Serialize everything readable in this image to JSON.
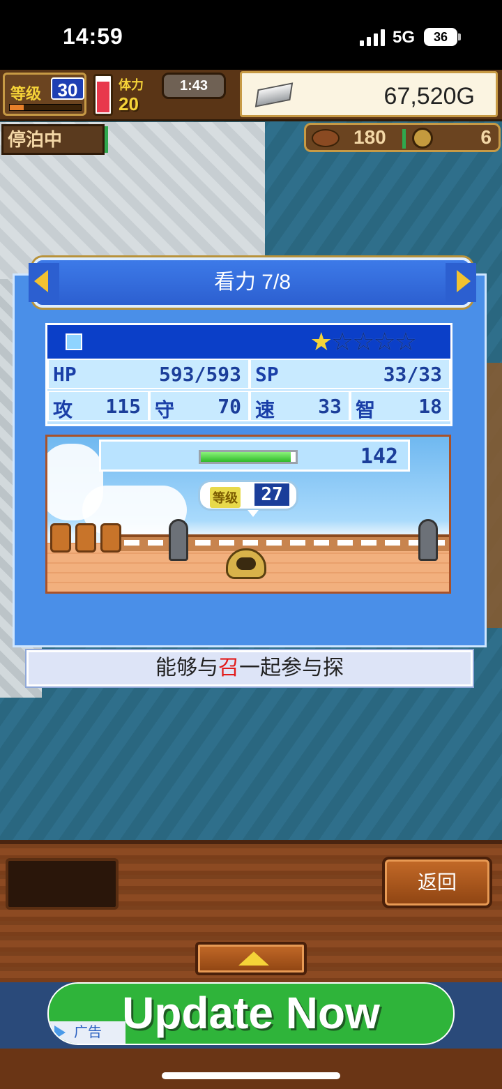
{
  "status_bar": {
    "time": "14:59",
    "network": "5G",
    "battery": "36"
  },
  "hud": {
    "level_label": "等级",
    "level_value": "30",
    "level_progress": 0.2,
    "stamina_label": "体力",
    "stamina_value": "20",
    "stamina_level": 0.85,
    "timer": "1:43",
    "gold": "67,520G",
    "anchor_status": "停泊中",
    "resource_food": "180",
    "resource_coin": "6"
  },
  "dialog": {
    "title": "看力 7/8",
    "stars_filled": 1,
    "stars_total": 5,
    "stars": {
      "filled": "★",
      "empty": "☆☆☆☆"
    },
    "stats": {
      "hp_label": "HP",
      "hp_value": "593/593",
      "sp_label": "SP",
      "sp_value": "33/33",
      "atk_label": "攻",
      "atk_value": "115",
      "def_label": "守",
      "def_value": "70",
      "spd_label": "速",
      "spd_value": "33",
      "int_label": "智",
      "int_value": "18"
    },
    "scene": {
      "exp_value": "142",
      "exp_fill": 0.95,
      "level_label": "等级",
      "level_value": "27"
    },
    "description": {
      "before": "能够与",
      "highlight": "召",
      "after": "一起参与探"
    }
  },
  "controls": {
    "back_label": "返回"
  },
  "ad": {
    "headline": "Update Now",
    "tag": "广告"
  },
  "colors": {
    "highlight": "#e21a1a",
    "star_on": "#f5d338",
    "dialog_blue": "#4a8fe8",
    "ad_green": "#2fb43a"
  }
}
